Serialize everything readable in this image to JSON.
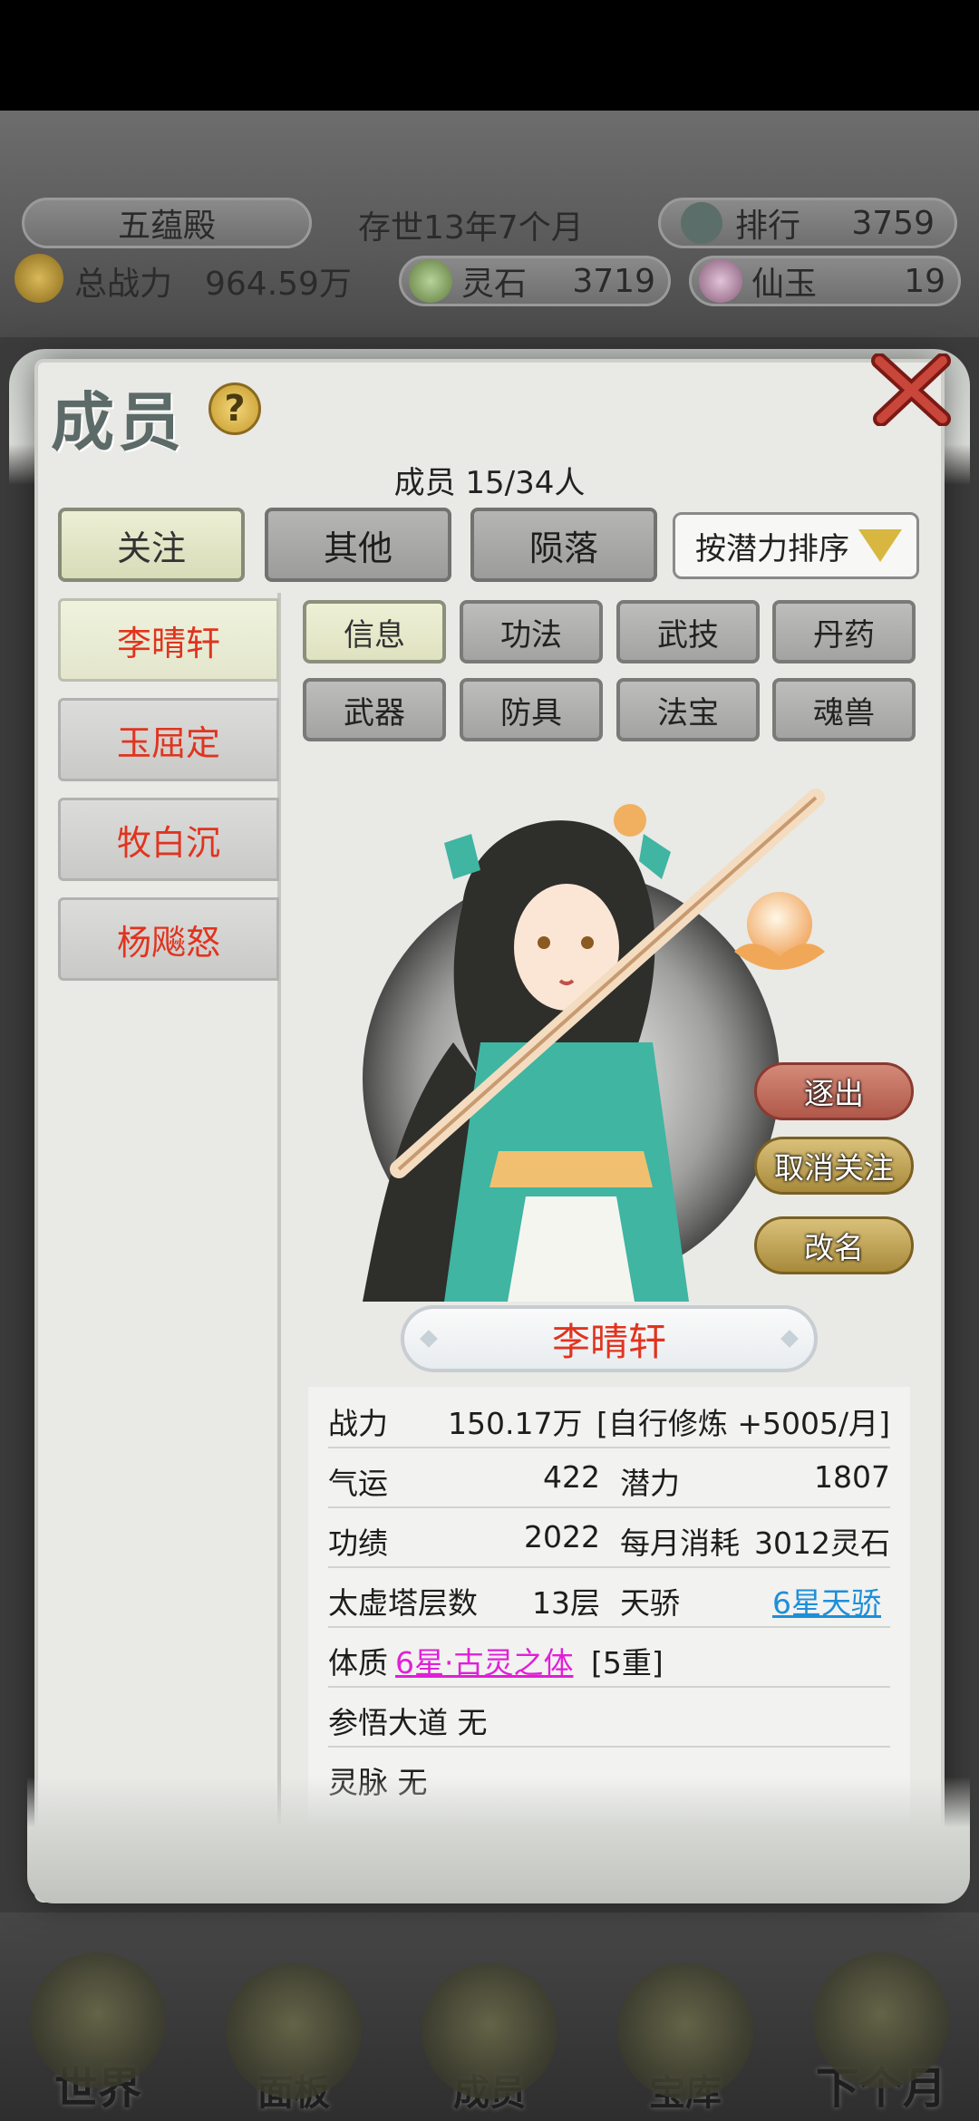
{
  "header": {
    "sect_name": "五蕴殿",
    "age": "存世13年7个月",
    "rank_label": "排行",
    "rank_value": "3759",
    "power_label": "总战力",
    "power_value": "964.59万",
    "spirit_stone_label": "灵石",
    "spirit_stone_value": "3719",
    "jade_label": "仙玉",
    "jade_value": "19"
  },
  "modal": {
    "title": "成员",
    "help": "?",
    "member_count": "成员  15/34人",
    "tabs": [
      {
        "label": "关注",
        "active": true
      },
      {
        "label": "其他",
        "active": false
      },
      {
        "label": "陨落",
        "active": false
      }
    ],
    "sort_label": "按潜力排序"
  },
  "members": [
    {
      "name": "李晴轩",
      "active": true
    },
    {
      "name": "玉屈定",
      "active": false
    },
    {
      "name": "牧白沉",
      "active": false
    },
    {
      "name": "杨飚怒",
      "active": false
    }
  ],
  "subtabs": [
    {
      "label": "信息",
      "active": true
    },
    {
      "label": "功法",
      "active": false
    },
    {
      "label": "武技",
      "active": false
    },
    {
      "label": "丹药",
      "active": false
    },
    {
      "label": "武器",
      "active": false
    },
    {
      "label": "防具",
      "active": false
    },
    {
      "label": "法宝",
      "active": false
    },
    {
      "label": "魂兽",
      "active": false
    }
  ],
  "actions": {
    "expel": "逐出",
    "unfollow": "取消关注",
    "rename": "改名"
  },
  "character": {
    "name": "李晴轩"
  },
  "stats": {
    "power_label": "战力",
    "power_value": "150.17万",
    "train": "[自行修炼 +5005/月]",
    "luck_label": "气运",
    "luck_value": "422",
    "potential_label": "潜力",
    "potential_value": "1807",
    "merit_label": "功绩",
    "merit_value": "2022",
    "cost_label": "每月消耗",
    "cost_value": "3012灵石",
    "tower_label": "太虚塔层数",
    "tower_value": "13层",
    "talent_label": "天骄",
    "talent_value": "6星天骄",
    "body_label": "体质",
    "body_value": "6星·古灵之体",
    "body_level": "[5重]",
    "dao_line": "参悟大道 无",
    "vein_line": "灵脉 无"
  },
  "nav": [
    {
      "label": "世界",
      "icon": "world-icon"
    },
    {
      "label": "面板",
      "icon": "panel-icon"
    },
    {
      "label": "成员",
      "icon": "members-icon"
    },
    {
      "label": "宝库",
      "icon": "treasury-icon"
    },
    {
      "label": "下个月",
      "icon": "next-month-icon"
    }
  ],
  "colors": {
    "member_name": "#e0341f",
    "talent_link": "#1d8fd9",
    "body_link": "#e020d8"
  }
}
